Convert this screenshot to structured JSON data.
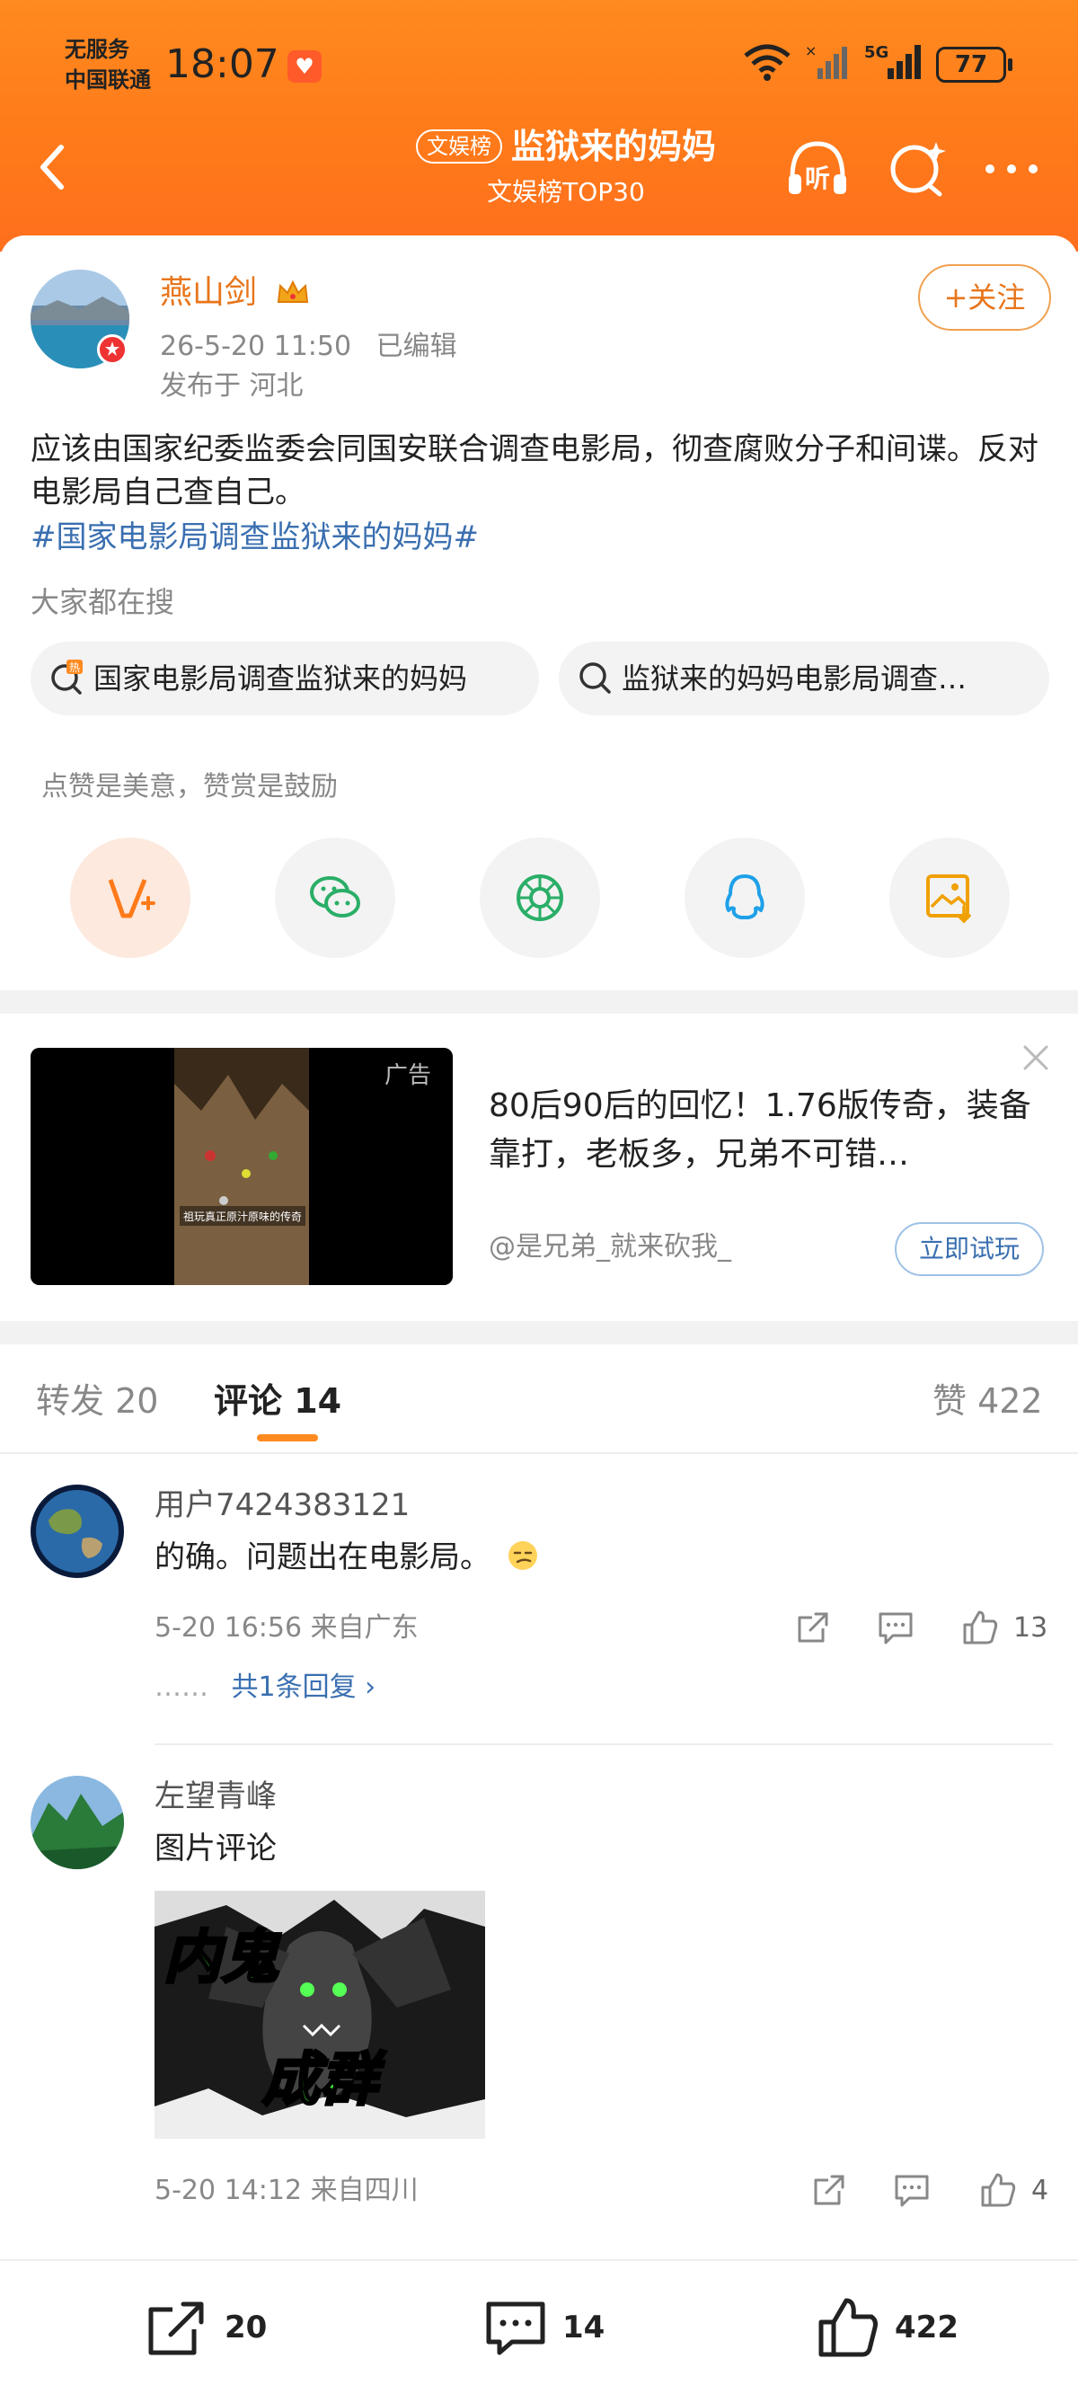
{
  "status_bar": {
    "carrier_line1": "无服务",
    "carrier_line2": "中国联通",
    "time": "18:07",
    "battery": "77"
  },
  "header": {
    "badge": "文娱榜",
    "title": "监狱来的妈妈",
    "subtitle": "文娱榜TOP30",
    "listen_label": "听"
  },
  "post": {
    "author": "燕山剑",
    "timestamp": "26-5-20 11:50",
    "edited": "已编辑",
    "location": "发布于 河北",
    "follow_label": "+关注",
    "text": "应该由国家纪委监委会同国安联合调查电影局，彻查腐败分子和间谍。反对电影局自己查自己。",
    "hashtag": "#国家电影局调查监狱来的妈妈#",
    "search_label": "大家都在搜",
    "search_chips": [
      {
        "text": "国家电影局调查监狱来的妈妈",
        "icon": "hot-search-icon"
      },
      {
        "text": "监狱来的妈妈电影局调查…",
        "icon": "search-icon"
      }
    ],
    "reward_tip": "点赞是美意，赞赏是鼓励",
    "share_icons": [
      "reward-v-icon",
      "wechat-icon",
      "moments-icon",
      "qq-icon",
      "save-image-icon"
    ]
  },
  "ad": {
    "tag": "广告",
    "image_caption": "祖玩真正原汁原味的传奇",
    "text": "80后90后的回忆！1.76版传奇，装备靠打，老板多，兄弟不可错…",
    "author": "@是兄弟_就来砍我_",
    "cta": "立即试玩"
  },
  "tabs": {
    "repost": "转发 20",
    "comment": "评论 14",
    "like": "赞 422"
  },
  "comments": [
    {
      "user": "用户7424383121",
      "text": "的确。问题出在电影局。",
      "time_loc": "5-20 16:56 来自广东",
      "likes": "13",
      "reply_dots": "……",
      "replies": "共1条回复 ›"
    },
    {
      "user": "左望青峰",
      "text": "图片评论",
      "image_text_1": "内鬼",
      "image_text_2": "成群",
      "time_loc": "5-20 14:12 来自四川",
      "likes": "4"
    }
  ],
  "bottom_bar": {
    "repost": "20",
    "comment": "14",
    "like": "422"
  },
  "colors": {
    "header_orange": "#ff7a1a",
    "author_orange": "#e8751a",
    "link_blue": "#3a6fb0",
    "meme_green": "#3fe03a"
  }
}
